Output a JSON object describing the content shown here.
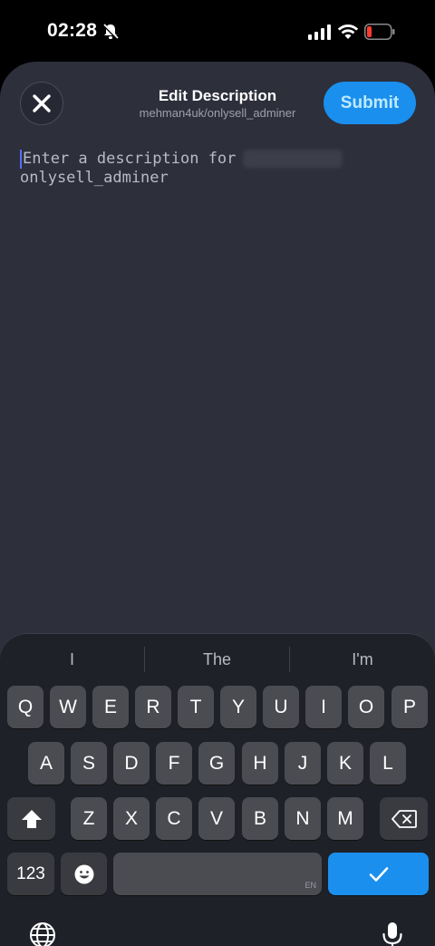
{
  "status_bar": {
    "time": "02:28"
  },
  "header": {
    "title": "Edit Description",
    "subtitle": "mehman4uk/onlysell_adminer",
    "submit_label": "Submit"
  },
  "editor": {
    "placeholder_line1": "Enter a description for",
    "placeholder_line2": "onlysell_adminer"
  },
  "keyboard": {
    "suggestions": [
      "I",
      "The",
      "I'm"
    ],
    "row1": [
      "Q",
      "W",
      "E",
      "R",
      "T",
      "Y",
      "U",
      "I",
      "O",
      "P"
    ],
    "row2": [
      "A",
      "S",
      "D",
      "F",
      "G",
      "H",
      "J",
      "K",
      "L"
    ],
    "row3": [
      "Z",
      "X",
      "C",
      "V",
      "B",
      "N",
      "M"
    ],
    "numbers_label": "123",
    "space_lang": "EN"
  },
  "colors": {
    "accent": "#1a8fee",
    "sheet_bg": "#2d2f3b",
    "keyboard_bg": "#1f2128",
    "key_bg": "#4b4c52"
  }
}
